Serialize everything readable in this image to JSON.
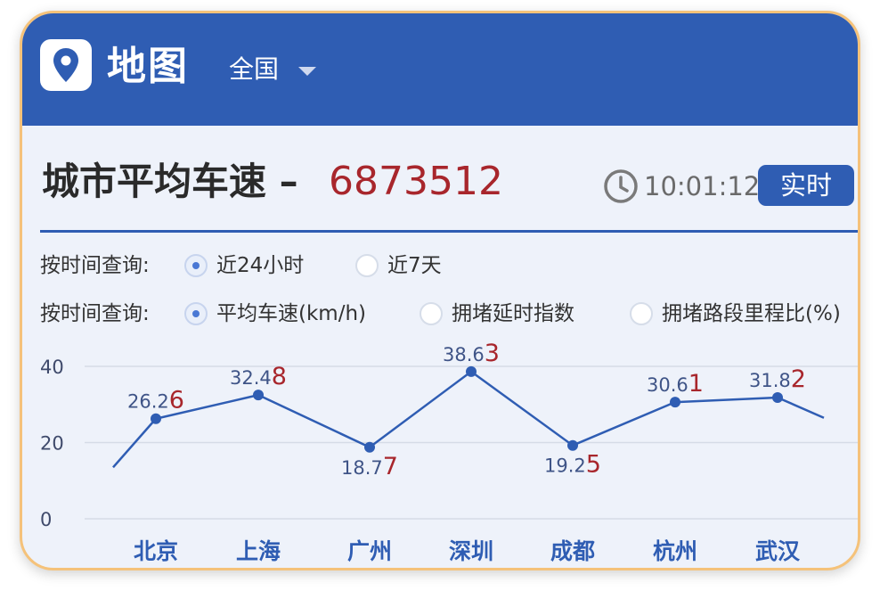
{
  "header": {
    "app_title": "地图",
    "region": "全国",
    "logo_icon": "map-pin-icon"
  },
  "title": {
    "label": "城市平均车速 –",
    "value": "6873512"
  },
  "status": {
    "time": "10:01:12",
    "live_label": "实时",
    "clock_icon": "clock-icon"
  },
  "filters": {
    "time_row_label": "按时间查询:",
    "time_options": [
      "近24小时",
      "近7天"
    ],
    "time_selected": 0,
    "metric_row_label": "按时间查询:",
    "metric_options": [
      "平均车速(km/h)",
      "拥堵延时指数",
      "拥堵路段里程比(%)"
    ],
    "metric_selected": 0
  },
  "colors": {
    "brand": "#2f5db3",
    "accent_red": "#a8262c",
    "frame": "#f5c27a"
  },
  "chart_data": {
    "type": "line",
    "categories": [
      "北京",
      "上海",
      "广州",
      "深圳",
      "成都",
      "杭州",
      "武汉"
    ],
    "values": [
      26.26,
      32.48,
      18.77,
      38.63,
      19.25,
      30.61,
      31.82
    ],
    "value_labels": [
      {
        "main": "26.2",
        "last": "6"
      },
      {
        "main": "32.4",
        "last": "8"
      },
      {
        "main": "18.7",
        "last": "7"
      },
      {
        "main": "38.6",
        "last": "3"
      },
      {
        "main": "19.2",
        "last": "5"
      },
      {
        "main": "30.6",
        "last": "1"
      },
      {
        "main": "31.8",
        "last": "2"
      }
    ],
    "y_ticks": [
      "40",
      "20",
      "0"
    ],
    "ylim": [
      0,
      40
    ],
    "grid": true,
    "title": "",
    "xlabel": "",
    "ylabel": ""
  }
}
